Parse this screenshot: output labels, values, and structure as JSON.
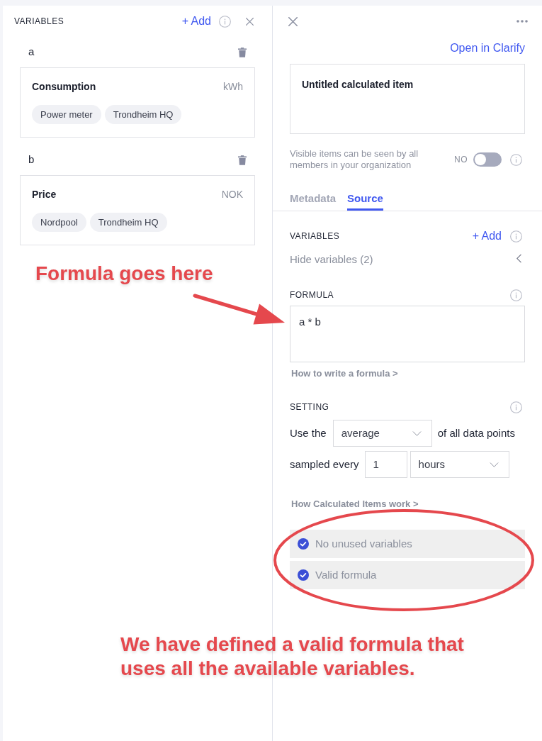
{
  "variables_panel": {
    "heading": "VARIABLES",
    "add_button": "+ Add",
    "variables": [
      {
        "letter": "a",
        "name": "Consumption",
        "unit": "kWh",
        "tags": [
          "Power meter",
          "Trondheim HQ"
        ]
      },
      {
        "letter": "b",
        "name": "Price",
        "unit": "NOK",
        "tags": [
          "Nordpool",
          "Trondheim HQ"
        ]
      }
    ]
  },
  "item_panel": {
    "open_link": "Open in Clarify",
    "title": "Untitled calculated item",
    "visibility": {
      "description": "Visible items can be seen by all members in your organization",
      "state_label": "NO",
      "on": false
    },
    "tabs": [
      {
        "label": "Metadata",
        "selected": false
      },
      {
        "label": "Source",
        "selected": true
      }
    ],
    "variables_section": {
      "heading": "VARIABLES",
      "add_button": "+ Add",
      "toggle_label": "Hide variables (2)"
    },
    "formula": {
      "heading": "FORMULA",
      "value": "a * b",
      "help_link": "How to write a formula >"
    },
    "setting": {
      "heading": "SETTING",
      "prefix": "Use the",
      "aggregation": "average",
      "suffix": "of all data points",
      "sample_label": "sampled every",
      "interval": "1",
      "interval_unit": "hours",
      "help_link": "How Calculated Items work >"
    },
    "checks": [
      {
        "label": "No unused variables",
        "checked": true
      },
      {
        "label": "Valid formula",
        "checked": true
      }
    ]
  },
  "annotations": {
    "formula_note": "Formula goes here",
    "checks_note": "We have defined a valid formula that uses all the available variables."
  }
}
